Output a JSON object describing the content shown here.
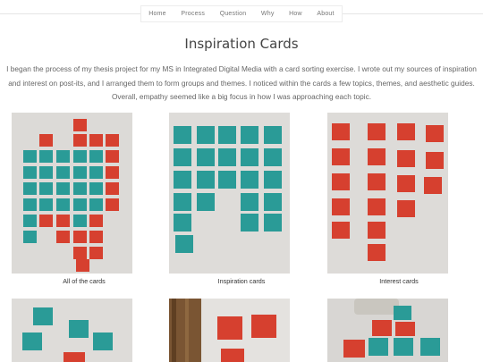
{
  "nav": {
    "items": [
      "Home",
      "Process",
      "Question",
      "Why",
      "How",
      "About"
    ]
  },
  "page": {
    "title": "Inspiration Cards",
    "intro": "I began the process of my thesis project for my MS in Integrated Digital Media with a card sorting exercise. I wrote out my sources of inspiration and interest on post-its, and I arranged them to form groups and themes. I noticed within the cards a few topics, themes, and aesthetic guides. Overall, empathy seemed like a big focus in how I was approaching each topic."
  },
  "gallery": {
    "captions": [
      "All of the cards",
      "Inspiration cards",
      "Interest cards"
    ]
  },
  "colors": {
    "teal_note": "#2a9b97",
    "red_note": "#d6402f",
    "wall": "#d9d7d4"
  }
}
